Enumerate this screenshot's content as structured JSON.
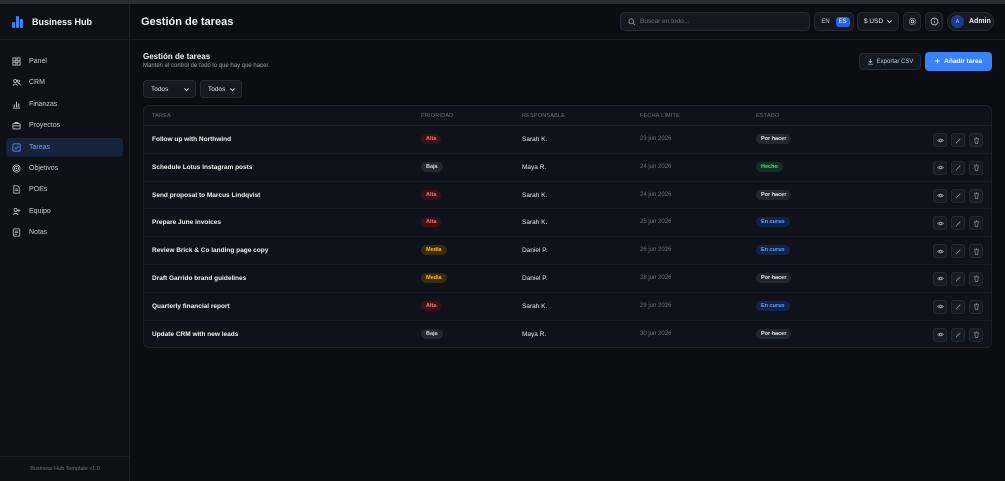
{
  "app": {
    "name": "Business Hub",
    "footer": "Business Hub Template v1.0"
  },
  "sidebar": {
    "items": [
      {
        "label": "Panel",
        "icon": "grid-icon",
        "active": false
      },
      {
        "label": "CRM",
        "icon": "users-icon",
        "active": false
      },
      {
        "label": "Finanzas",
        "icon": "bar-chart-icon",
        "active": false
      },
      {
        "label": "Proyectos",
        "icon": "briefcase-icon",
        "active": false
      },
      {
        "label": "Tareas",
        "icon": "checkbox-icon",
        "active": true
      },
      {
        "label": "Objetivos",
        "icon": "target-icon",
        "active": false
      },
      {
        "label": "POEs",
        "icon": "document-icon",
        "active": false
      },
      {
        "label": "Equipo",
        "icon": "team-icon",
        "active": false
      },
      {
        "label": "Notas",
        "icon": "note-icon",
        "active": false
      }
    ]
  },
  "header": {
    "title": "Gestión de tareas",
    "search_placeholder": "Buscar en todo...",
    "lang_en": "EN",
    "lang_es": "ES",
    "currency": "$ USD",
    "user_initial": "A",
    "user_name": "Admin"
  },
  "page": {
    "title": "Gestión de tareas",
    "subtitle": "Mantén el control de todo lo que hay que hacer.",
    "export_label": "Exportar CSV",
    "add_label": "Añadir tarea",
    "filter_1": "Todos",
    "filter_2": "Todos"
  },
  "table": {
    "columns": {
      "task": "TAREA",
      "priority": "PRIORIDAD",
      "owner": "RESPONSABLE",
      "due": "FECHA LÍMITE",
      "status": "ESTADO"
    },
    "rows": [
      {
        "task": "Follow up with Northwind",
        "priority": "Alta",
        "owner": "Sarah K.",
        "due": "23 jun 2026",
        "status": "Por hacer"
      },
      {
        "task": "Schedule Lotus Instagram posts",
        "priority": "Baja",
        "owner": "Maya R.",
        "due": "24 jun 2026",
        "status": "Hecho"
      },
      {
        "task": "Send proposal to Marcus Lindqvist",
        "priority": "Alta",
        "owner": "Sarah K.",
        "due": "24 jun 2026",
        "status": "Por hacer"
      },
      {
        "task": "Prepare June invoices",
        "priority": "Alta",
        "owner": "Sarah K.",
        "due": "25 jun 2026",
        "status": "En curso"
      },
      {
        "task": "Review Brick & Co landing page copy",
        "priority": "Media",
        "owner": "Daniel P.",
        "due": "26 jun 2026",
        "status": "En curso"
      },
      {
        "task": "Draft Garrido brand guidelines",
        "priority": "Media",
        "owner": "Daniel P.",
        "due": "28 jun 2026",
        "status": "Por hacer"
      },
      {
        "task": "Quarterly financial report",
        "priority": "Alta",
        "owner": "Sarah K.",
        "due": "29 jun 2026",
        "status": "En curso"
      },
      {
        "task": "Update CRM with new leads",
        "priority": "Baja",
        "owner": "Maya R.",
        "due": "30 jun 2026",
        "status": "Por hacer"
      }
    ]
  },
  "colors": {
    "accent": "#3b82f6",
    "priority": {
      "Alta": [
        "#3a1216",
        "#f87171"
      ],
      "Media": [
        "#3a2a0a",
        "#fbbf24"
      ],
      "Baja": [
        "#23272f",
        "#d1d5db"
      ]
    },
    "status": {
      "Por hacer": [
        "#23272f",
        "#e5e7eb"
      ],
      "Hecho": [
        "#0f3321",
        "#4ade80"
      ],
      "En curso": [
        "#12244a",
        "#60a5fa"
      ]
    }
  }
}
